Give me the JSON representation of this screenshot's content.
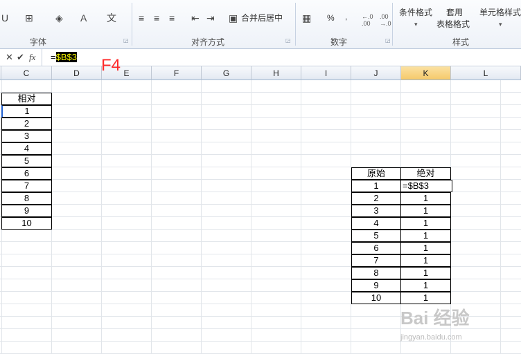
{
  "ribbon": {
    "groups": [
      {
        "label": "字体"
      },
      {
        "label": "对齐方式"
      },
      {
        "label": "数字"
      },
      {
        "label": "样式"
      }
    ],
    "merge_center": "合并后居中",
    "percent": "%",
    "comma": ",",
    "cond_format": "条件格式",
    "table_format_1": "套用",
    "table_format_2": "表格格式",
    "cell_style": "单元格样式"
  },
  "formula_bar": {
    "prefix": "=",
    "highlighted": "$B$3"
  },
  "annotation": "F4",
  "columns": [
    "C",
    "D",
    "E",
    "F",
    "G",
    "H",
    "I",
    "J",
    "K",
    "L"
  ],
  "selected_column": "K",
  "left_table": {
    "header": "相对",
    "values": [
      "1",
      "2",
      "3",
      "4",
      "5",
      "6",
      "7",
      "8",
      "9",
      "10"
    ]
  },
  "right_table": {
    "header_a": "原始",
    "header_b": "绝对",
    "a_values": [
      "1",
      "2",
      "3",
      "4",
      "5",
      "6",
      "7",
      "8",
      "9",
      "10"
    ],
    "b_edit": "=$B$3",
    "b_values": [
      "1",
      "1",
      "1",
      "1",
      "1",
      "1",
      "1",
      "1",
      "1"
    ]
  },
  "watermark": {
    "text": "Bai 经验",
    "url": "jingyan.baidu.com"
  }
}
